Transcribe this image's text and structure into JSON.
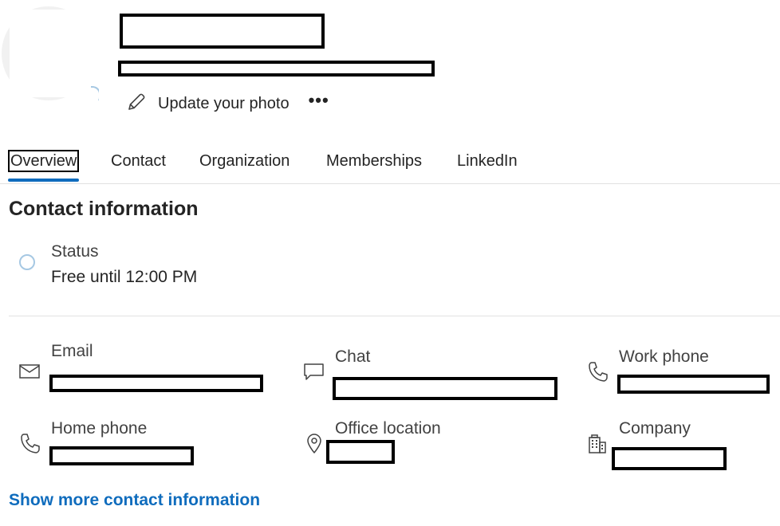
{
  "header": {
    "update_photo_label": "Update your photo",
    "more_label": "•••"
  },
  "tabs": [
    {
      "label": "Overview",
      "active": true
    },
    {
      "label": "Contact"
    },
    {
      "label": "Organization"
    },
    {
      "label": "Memberships"
    },
    {
      "label": "LinkedIn"
    }
  ],
  "contact": {
    "section_title": "Contact information",
    "status": {
      "label": "Status",
      "value": "Free until 12:00 PM"
    },
    "fields": {
      "email": {
        "label": "Email",
        "icon": "mail-icon"
      },
      "chat": {
        "label": "Chat",
        "icon": "chat-icon"
      },
      "work_phone": {
        "label": "Work phone",
        "icon": "phone-icon"
      },
      "home_phone": {
        "label": "Home phone",
        "icon": "phone-icon"
      },
      "office_location": {
        "label": "Office location",
        "icon": "location-pin-icon"
      },
      "company": {
        "label": "Company",
        "icon": "building-icon"
      }
    },
    "show_more_label": "Show more contact information"
  },
  "colors": {
    "accent": "#0f6cbd",
    "status_ring": "#a6c8e3",
    "divider": "#e1e1e1"
  }
}
